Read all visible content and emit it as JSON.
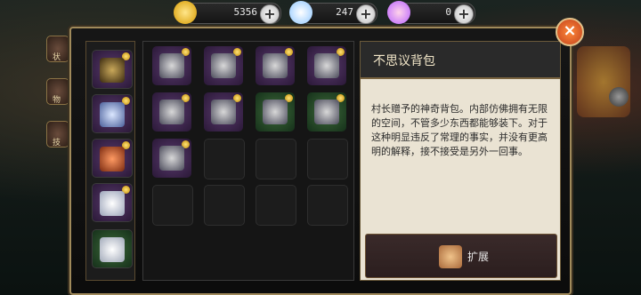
{
  "currency": [
    {
      "name": "gold-coins",
      "value": "5356",
      "color": "#f3c21b"
    },
    {
      "name": "crystal",
      "value": "247",
      "color": "#bfe3ff"
    },
    {
      "name": "orb",
      "value": "0",
      "color": "#ff9acb"
    }
  ],
  "side_tabs": [
    {
      "label": "状"
    },
    {
      "label": "物"
    },
    {
      "label": "技"
    }
  ],
  "detail": {
    "title": "不思议背包",
    "description": "村长赠予的神奇背包。内部仿佛拥有无限的空间，不管多少东西都能够装下。对于这种明显违反了常理的事实，并没有更高明的解释，接不接受是另外一回事。"
  },
  "expand_button": {
    "label": "扩展"
  },
  "equipped_slots": [
    {
      "item": "dark-helmet-icon",
      "rarity": "purple"
    },
    {
      "item": "armor-chest-icon",
      "rarity": "purple"
    },
    {
      "item": "gauntlet-icon",
      "rarity": "purple"
    },
    {
      "item": "crown-icon",
      "rarity": "purple"
    },
    {
      "item": "boots-icon",
      "rarity": "green"
    }
  ],
  "bag_slots": [
    {
      "item": "black-helmet-icon",
      "rarity": "purple"
    },
    {
      "item": "gold-helmet-icon",
      "rarity": "purple"
    },
    {
      "item": "shoulder-armor-icon",
      "rarity": "purple"
    },
    {
      "item": "gauntlet-icon",
      "rarity": "purple"
    },
    {
      "item": "belt-icon",
      "rarity": "purple"
    },
    {
      "item": "bracelet-icon",
      "rarity": "purple"
    },
    {
      "item": "purple-ring-icon",
      "rarity": "green"
    },
    {
      "item": "gold-ring-icon",
      "rarity": "green"
    },
    {
      "item": "lantern-icon",
      "rarity": "purple"
    },
    {
      "item": "",
      "rarity": "empty"
    },
    {
      "item": "",
      "rarity": "empty"
    },
    {
      "item": "",
      "rarity": "empty"
    },
    {
      "item": "",
      "rarity": "empty"
    },
    {
      "item": "",
      "rarity": "empty"
    },
    {
      "item": "",
      "rarity": "empty"
    },
    {
      "item": "",
      "rarity": "empty"
    }
  ]
}
